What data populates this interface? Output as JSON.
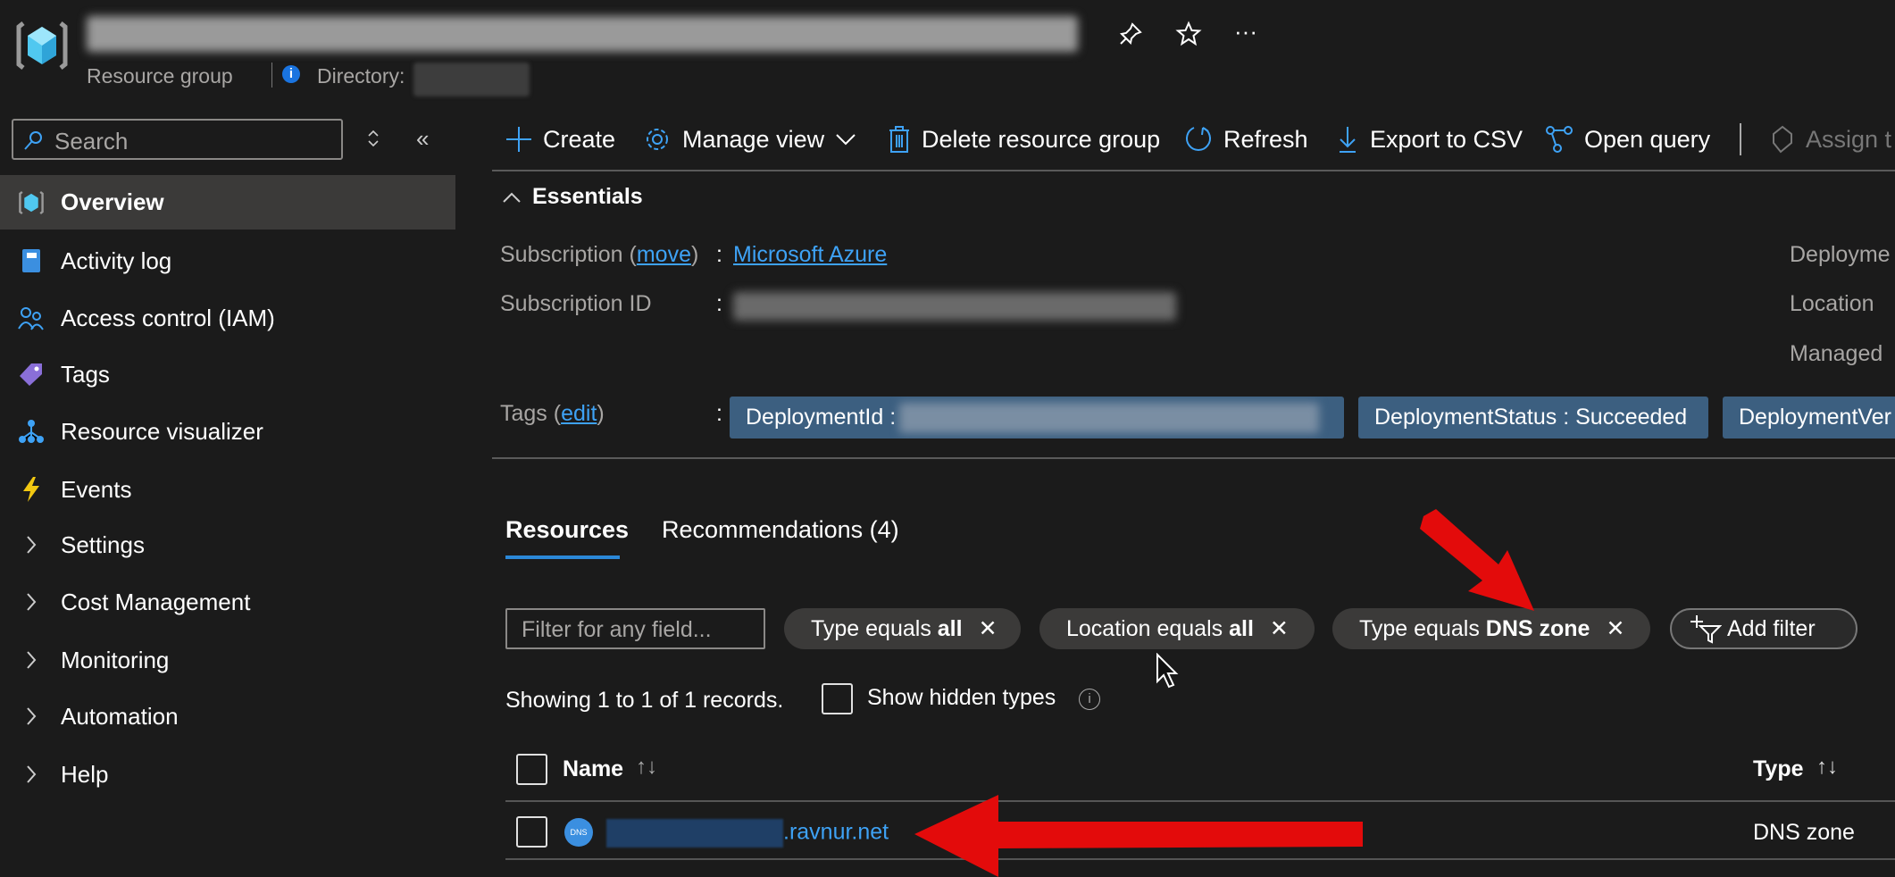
{
  "header": {
    "subtitle": "Resource group",
    "directory_label": "Directory:",
    "icons": [
      "resource-group-icon",
      "pin-icon",
      "star-icon",
      "more-icon",
      "info-icon"
    ]
  },
  "sidebar": {
    "search_placeholder": "Search",
    "items": [
      {
        "label": "Overview",
        "icon": "resource-group-icon",
        "selected": true
      },
      {
        "label": "Activity log",
        "icon": "book-icon"
      },
      {
        "label": "Access control (IAM)",
        "icon": "people-icon"
      },
      {
        "label": "Tags",
        "icon": "tag-icon"
      },
      {
        "label": "Resource visualizer",
        "icon": "hierarchy-icon"
      },
      {
        "label": "Events",
        "icon": "lightning-icon"
      },
      {
        "label": "Settings",
        "icon": "chevron-right-icon"
      },
      {
        "label": "Cost Management",
        "icon": "chevron-right-icon"
      },
      {
        "label": "Monitoring",
        "icon": "chevron-right-icon"
      },
      {
        "label": "Automation",
        "icon": "chevron-right-icon"
      },
      {
        "label": "Help",
        "icon": "chevron-right-icon"
      }
    ]
  },
  "toolbar": {
    "create": "Create",
    "manage_view": "Manage view",
    "delete": "Delete resource group",
    "refresh": "Refresh",
    "export": "Export to CSV",
    "open_query": "Open query",
    "assign": "Assign t"
  },
  "essentials": {
    "title": "Essentials",
    "subscription_label": "Subscription",
    "move": "move",
    "subscription_value": "Microsoft Azure",
    "subscription_id_label": "Subscription ID",
    "tags_label": "Tags",
    "edit": "edit",
    "colon": ":",
    "right_labels": [
      "Deployme",
      "Location",
      "Managed"
    ],
    "tags": [
      "DeploymentId : ",
      "DeploymentStatus : Succeeded",
      "DeploymentVer"
    ]
  },
  "tabs": [
    {
      "label": "Resources",
      "active": true
    },
    {
      "label": "Recommendations (4)"
    }
  ],
  "filters": {
    "placeholder": "Filter for any field...",
    "chips": [
      {
        "prefix": "Type equals ",
        "value": "all"
      },
      {
        "prefix": "Location equals ",
        "value": "all"
      },
      {
        "prefix": "Type equals ",
        "value": "DNS zone"
      }
    ],
    "add_filter": "Add filter"
  },
  "records": {
    "showing": "Showing 1 to 1 of 1 records.",
    "show_hidden": "Show hidden types"
  },
  "table": {
    "columns": [
      "Name",
      "Type"
    ],
    "rows": [
      {
        "name_suffix": ".ravnur.net",
        "type": "DNS zone",
        "icon_text": "DNS"
      }
    ]
  },
  "colors": {
    "accent": "#3ea2f5",
    "annotation_arrow": "#e30b0b",
    "tag_bg": "#3c5f80"
  }
}
